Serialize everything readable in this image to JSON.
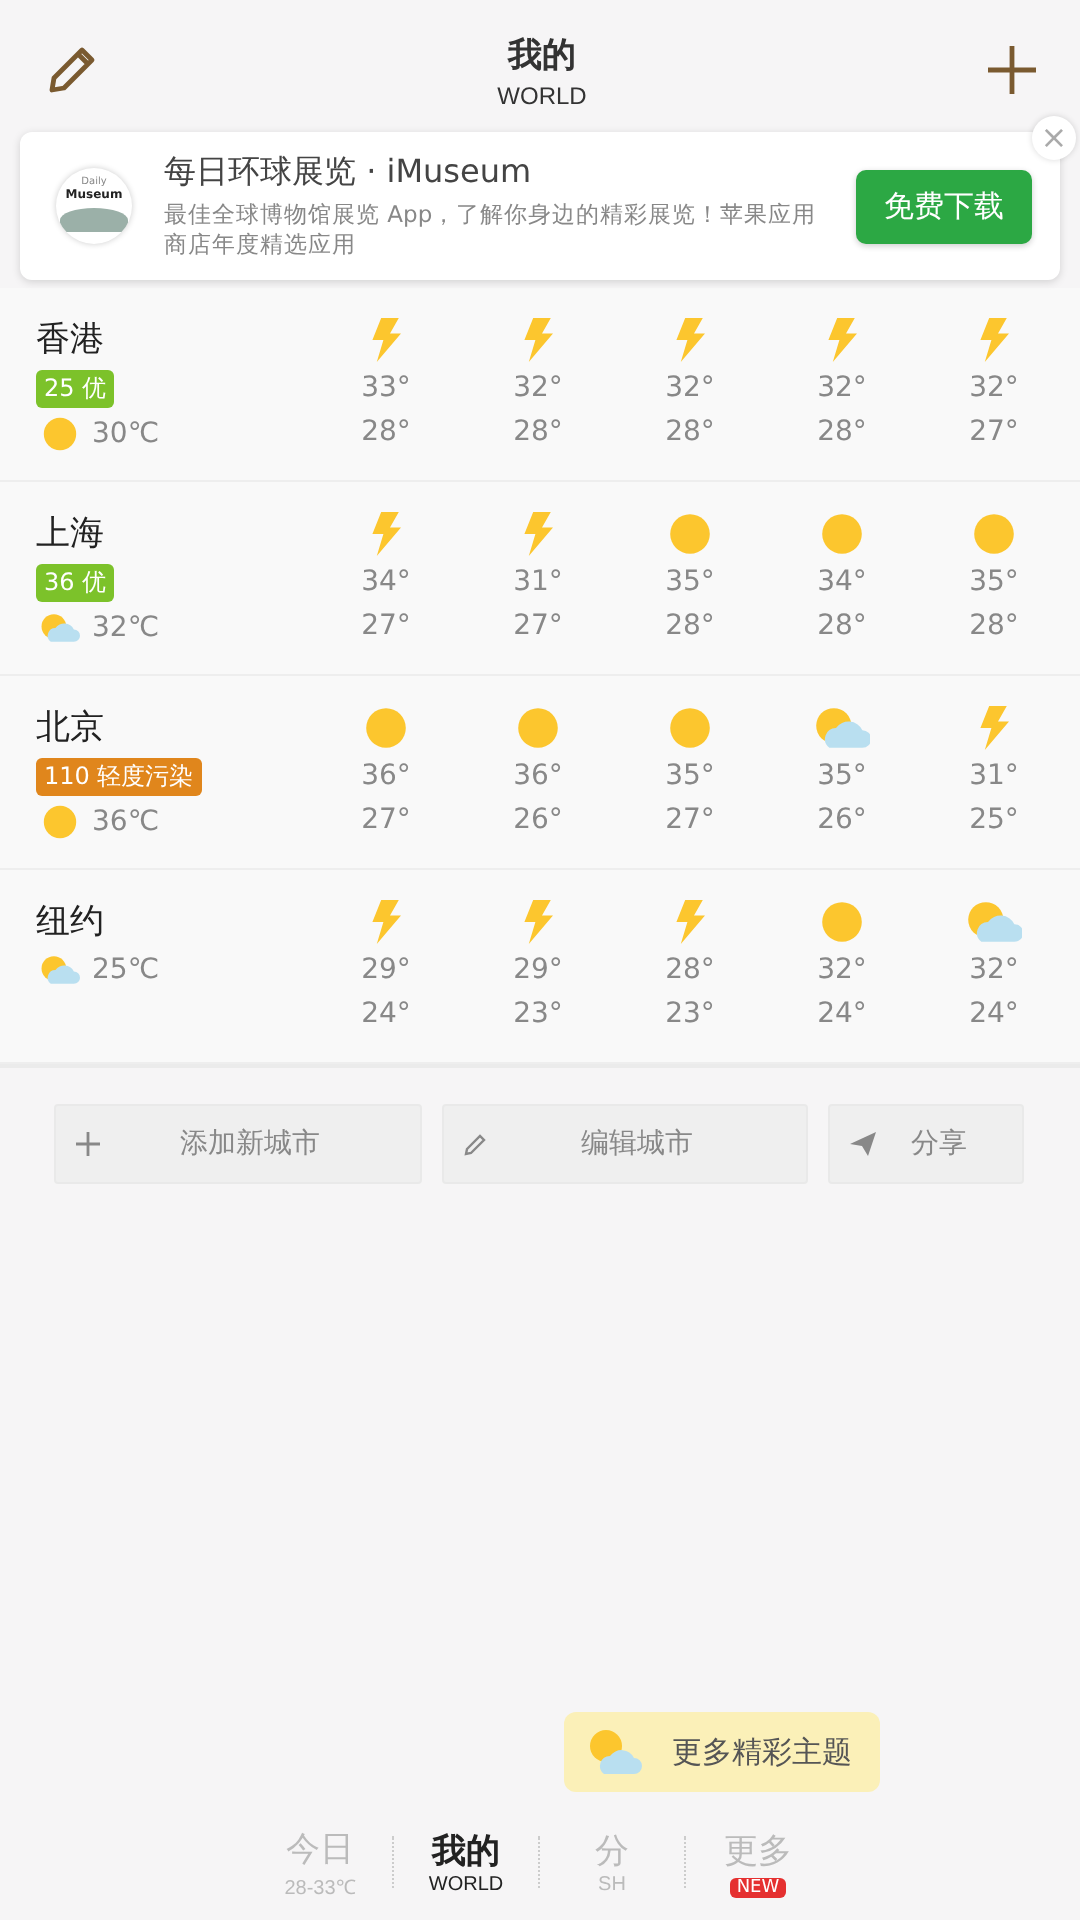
{
  "header": {
    "title": "我的",
    "subtitle": "WORLD"
  },
  "ad": {
    "logo": {
      "line_1": "Daily",
      "line_2": "Museum"
    },
    "title": "每日环球展览 · iMuseum",
    "description": "最佳全球博物馆展览 App，了解你身边的精彩展览！苹果应用商店年度精选应用",
    "button": "免费下载",
    "close": "×"
  },
  "cities": [
    {
      "name": "香港",
      "aqi": {
        "text": "25 优",
        "color": "#7cc22a"
      },
      "current": {
        "kind": "sunny",
        "temp": "30℃"
      },
      "forecast": [
        {
          "kind": "thunder",
          "high": "33°",
          "low": "28°"
        },
        {
          "kind": "thunder",
          "high": "32°",
          "low": "28°"
        },
        {
          "kind": "thunder",
          "high": "32°",
          "low": "28°"
        },
        {
          "kind": "thunder",
          "high": "32°",
          "low": "28°"
        },
        {
          "kind": "thunder",
          "high": "32°",
          "low": "27°"
        }
      ]
    },
    {
      "name": "上海",
      "aqi": {
        "text": "36 优",
        "color": "#7cc22a"
      },
      "current": {
        "kind": "partly-cloudy",
        "temp": "32℃"
      },
      "forecast": [
        {
          "kind": "thunder",
          "high": "34°",
          "low": "27°"
        },
        {
          "kind": "thunder",
          "high": "31°",
          "low": "27°"
        },
        {
          "kind": "sunny",
          "high": "35°",
          "low": "28°"
        },
        {
          "kind": "sunny",
          "high": "34°",
          "low": "28°"
        },
        {
          "kind": "sunny",
          "high": "35°",
          "low": "28°"
        }
      ]
    },
    {
      "name": "北京",
      "aqi": {
        "text": "110 轻度污染",
        "color": "#e0861c"
      },
      "current": {
        "kind": "sunny",
        "temp": "36℃"
      },
      "forecast": [
        {
          "kind": "sunny",
          "high": "36°",
          "low": "27°"
        },
        {
          "kind": "sunny",
          "high": "36°",
          "low": "26°"
        },
        {
          "kind": "sunny",
          "high": "35°",
          "low": "27°"
        },
        {
          "kind": "partly-cloudy",
          "high": "35°",
          "low": "26°"
        },
        {
          "kind": "thunder",
          "high": "31°",
          "low": "25°"
        }
      ]
    },
    {
      "name": "纽约",
      "current": {
        "kind": "partly-cloudy",
        "temp": "25℃"
      },
      "forecast": [
        {
          "kind": "thunder",
          "high": "29°",
          "low": "24°"
        },
        {
          "kind": "thunder",
          "high": "29°",
          "low": "23°"
        },
        {
          "kind": "thunder",
          "high": "28°",
          "low": "23°"
        },
        {
          "kind": "sunny",
          "high": "32°",
          "low": "24°"
        },
        {
          "kind": "partly-cloudy",
          "high": "32°",
          "low": "24°"
        }
      ]
    }
  ],
  "actions": [
    {
      "kind": "add",
      "label": "添加新城市"
    },
    {
      "kind": "edit",
      "label": "编辑城市"
    },
    {
      "kind": "share",
      "label": "分享"
    }
  ],
  "theme_button": {
    "label": "更多精彩主题"
  },
  "tabs": [
    {
      "label": "今日",
      "sublabel": "28-33℃",
      "selected": false
    },
    {
      "label": "我的",
      "sublabel": "WORLD",
      "selected": true
    },
    {
      "label": "分",
      "sublabel": "SH",
      "selected": false
    },
    {
      "label": "更多",
      "badge": "NEW",
      "selected": false
    }
  ]
}
